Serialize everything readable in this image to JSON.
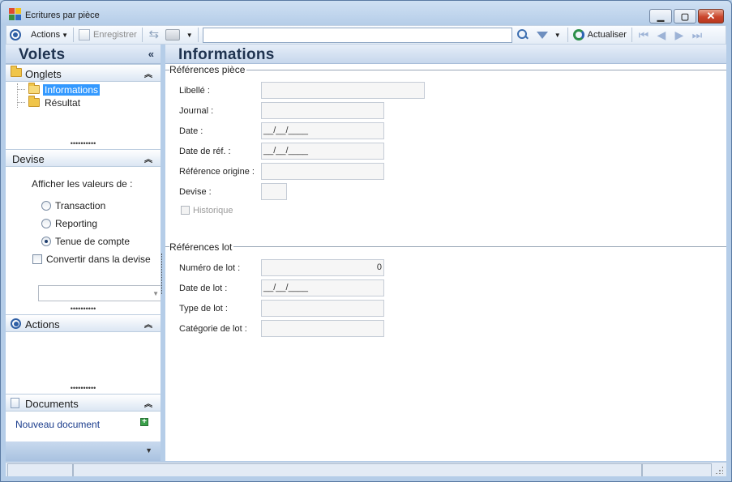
{
  "window": {
    "title": "Ecritures par pièce"
  },
  "toolbar": {
    "actions_label": "Actions",
    "save_label": "Enregistrer",
    "search": {
      "value": "",
      "placeholder": ""
    },
    "refresh_label": "Actualiser"
  },
  "left_panel": {
    "title": "Volets",
    "collapse_glyph": "«",
    "onglets": {
      "title": "Onglets",
      "items": [
        {
          "label": "Informations",
          "selected": true
        },
        {
          "label": "Résultat",
          "selected": false
        }
      ]
    },
    "devise": {
      "title": "Devise",
      "question": "Afficher les valeurs de :",
      "options": [
        {
          "label": "Transaction",
          "checked": false
        },
        {
          "label": "Reporting",
          "checked": false
        },
        {
          "label": "Tenue de compte",
          "checked": true
        }
      ],
      "convert_label": "Convertir dans la devise",
      "currency_value": ""
    },
    "actions": {
      "title": "Actions"
    },
    "documents": {
      "title": "Documents",
      "new_document": "Nouveau document"
    }
  },
  "main": {
    "title": "Informations",
    "references_piece": {
      "title": "Références pièce",
      "fields": [
        {
          "label": "Libellé :",
          "value": ""
        },
        {
          "label": "Journal :",
          "value": ""
        },
        {
          "label": "Date :",
          "value": "__/__/____"
        },
        {
          "label": "Date de réf. :",
          "value": "__/__/____"
        },
        {
          "label": "Référence origine :",
          "value": ""
        },
        {
          "label": "Devise :",
          "value": ""
        }
      ],
      "historique_label": "Historique"
    },
    "references_lot": {
      "title": "Références lot",
      "fields": [
        {
          "label": "Numéro de lot :",
          "value": "0"
        },
        {
          "label": "Date de lot :",
          "value": "__/__/____"
        },
        {
          "label": "Type de lot :",
          "value": ""
        },
        {
          "label": "Catégorie de lot :",
          "value": ""
        }
      ]
    }
  },
  "colors": {
    "accent": "#3399ff",
    "header_text": "#1f3350",
    "link": "#1a3c8c"
  }
}
